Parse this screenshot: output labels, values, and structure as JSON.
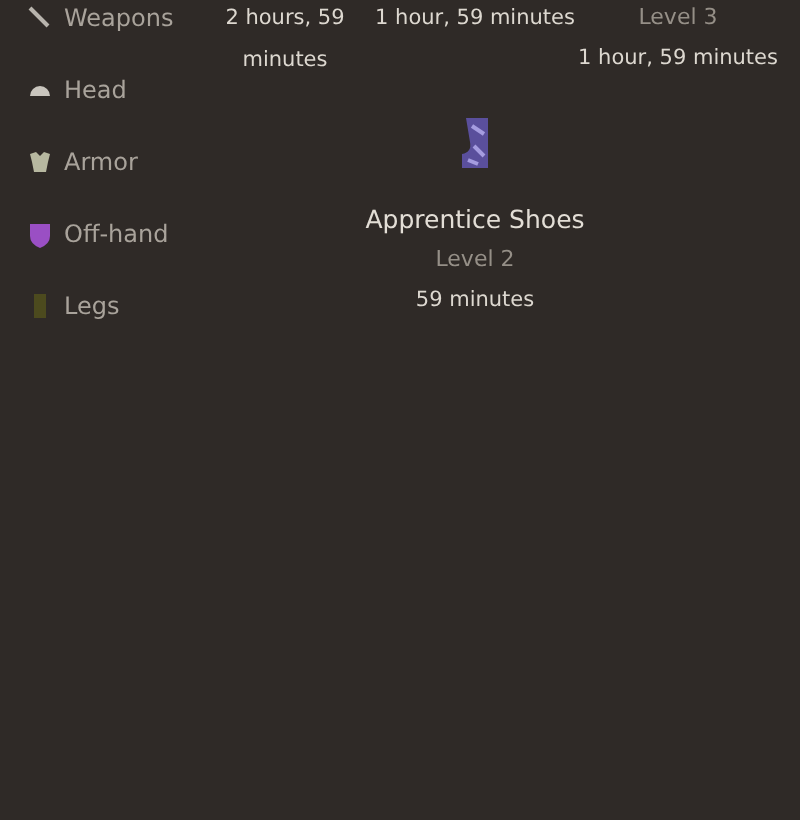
{
  "sidebar": {
    "items": [
      {
        "label": "Weapons"
      },
      {
        "label": "Head"
      },
      {
        "label": "Armor"
      },
      {
        "label": "Off-hand"
      },
      {
        "label": "Legs"
      }
    ]
  },
  "items": [
    {
      "time": "2 hours, 59 minutes"
    },
    {
      "time": "1 hour, 59 minutes"
    },
    {
      "level": "Level 3",
      "time": "1 hour, 59 minutes"
    },
    {
      "name": "Apprentice Shoes",
      "level": "Level 2",
      "time": "59 minutes"
    }
  ]
}
